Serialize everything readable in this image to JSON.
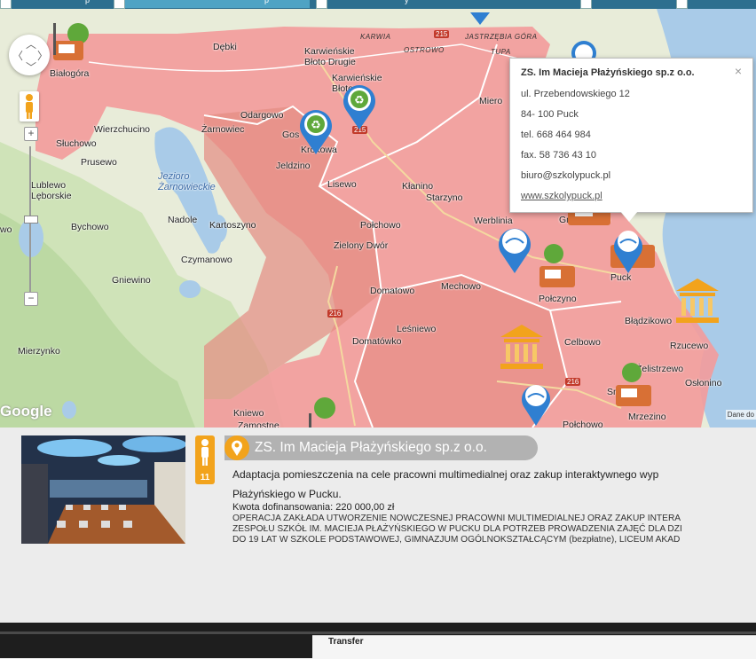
{
  "tabs": [
    {
      "label": "p"
    },
    {
      "label": "p"
    },
    {
      "label": "y"
    },
    {
      "label": ""
    },
    {
      "label": ""
    }
  ],
  "map": {
    "places": [
      {
        "name": "Białogóra"
      },
      {
        "name": "Dębki"
      },
      {
        "name": "Karwieńskie Błoto Drugie"
      },
      {
        "name": "Karwieńskie Błoto"
      },
      {
        "name": "Odargowo"
      },
      {
        "name": "Wierzchucino"
      },
      {
        "name": "Żarnowiec"
      },
      {
        "name": "Gos"
      },
      {
        "name": "Krokowa"
      },
      {
        "name": "Słuchowo"
      },
      {
        "name": "Prusewo"
      },
      {
        "name": "Jeldzino"
      },
      {
        "name": "Lublewo Lęborskie"
      },
      {
        "name": "Lisewo"
      },
      {
        "name": "Kłanino"
      },
      {
        "name": "Starzyno"
      },
      {
        "name": "Miero"
      },
      {
        "name": "Bychowo"
      },
      {
        "name": "Nadole"
      },
      {
        "name": "Kartoszyno"
      },
      {
        "name": "Połchowo"
      },
      {
        "name": "Werblinia"
      },
      {
        "name": "Gnieżdżewo"
      },
      {
        "name": "Czymanowo"
      },
      {
        "name": "Zielony Dwór"
      },
      {
        "name": "Gniewino"
      },
      {
        "name": "Domatowo"
      },
      {
        "name": "Mechowo"
      },
      {
        "name": "Puck"
      },
      {
        "name": "Połczyno"
      },
      {
        "name": "Błądzikowo"
      },
      {
        "name": "Leśniewo"
      },
      {
        "name": "Rzucewo"
      },
      {
        "name": "Mierzynko"
      },
      {
        "name": "Domatówko"
      },
      {
        "name": "Celbowo"
      },
      {
        "name": "Żelistrzewo"
      },
      {
        "name": "Osłonino"
      },
      {
        "name": "Mrzezino"
      },
      {
        "name": "Kniewo"
      },
      {
        "name": "Zamostne"
      },
      {
        "name": "Połchowo"
      },
      {
        "name": "Sn"
      },
      {
        "name": "wo"
      }
    ],
    "lake_label": "Jezioro Żarnowieckie",
    "road_names": [
      "KARWIA",
      "OSTROWO",
      "JASTRZĘBIA GÓRA",
      "TUPA"
    ],
    "road_numbers": [
      "215",
      "215",
      "216",
      "216"
    ],
    "attribution": "Google",
    "data_notice": "Dane do"
  },
  "popup": {
    "title": "ZS. Im Macieja Płażyńskiego sp.z o.o.",
    "close": "×",
    "address": "ul. Przebendowskiego 12",
    "city": "84- 100 Puck",
    "tel": "tel. 668 464 984",
    "fax": "fax. 58 736 43 10",
    "email": "biuro@szkolypuck.pl",
    "www": "www.szkolypuck.pl"
  },
  "info": {
    "badge_number": "11",
    "title": "ZS. Im Macieja Płażyńskiego sp.z o.o.",
    "desc_line1": "Adaptacja pomieszczenia na cele pracowni multimedialnej oraz zakup interaktywnego wyp",
    "desc_line2": "Płażyńskiego w Pucku.",
    "amount_label": "Kwota dofinansowania:",
    "amount_value": "220 000,00 zł",
    "opis_line1": "OPERACJA ZAKŁADA UTWORZENIE NOWCZESNEJ PRACOWNI MULTIMEDIALNEJ ORAZ ZAKUP INTERA",
    "opis_line2": "ZESPOŁU SZKÓŁ IM. MACIEJA PŁAŻYŃSKIEGO W PUCKU DLA POTRZEB PROWADZENIA ZAJĘĆ DLA DZI",
    "opis_line3": "DO 19 LAT W SZKOLE PODSTAWOWEJ, GIMNAZJUM OGÓLNOKSZTAŁCĄCYM (bezpłatne), LICEUM AKAD"
  },
  "taskbar": {
    "transfer_label": "Transfer"
  },
  "colors": {
    "region": "#f29c9c",
    "region_dark": "#e2867a",
    "water": "#a9cbe8",
    "accent": "#f2a31c",
    "tabbar": "#2d6f8f"
  }
}
